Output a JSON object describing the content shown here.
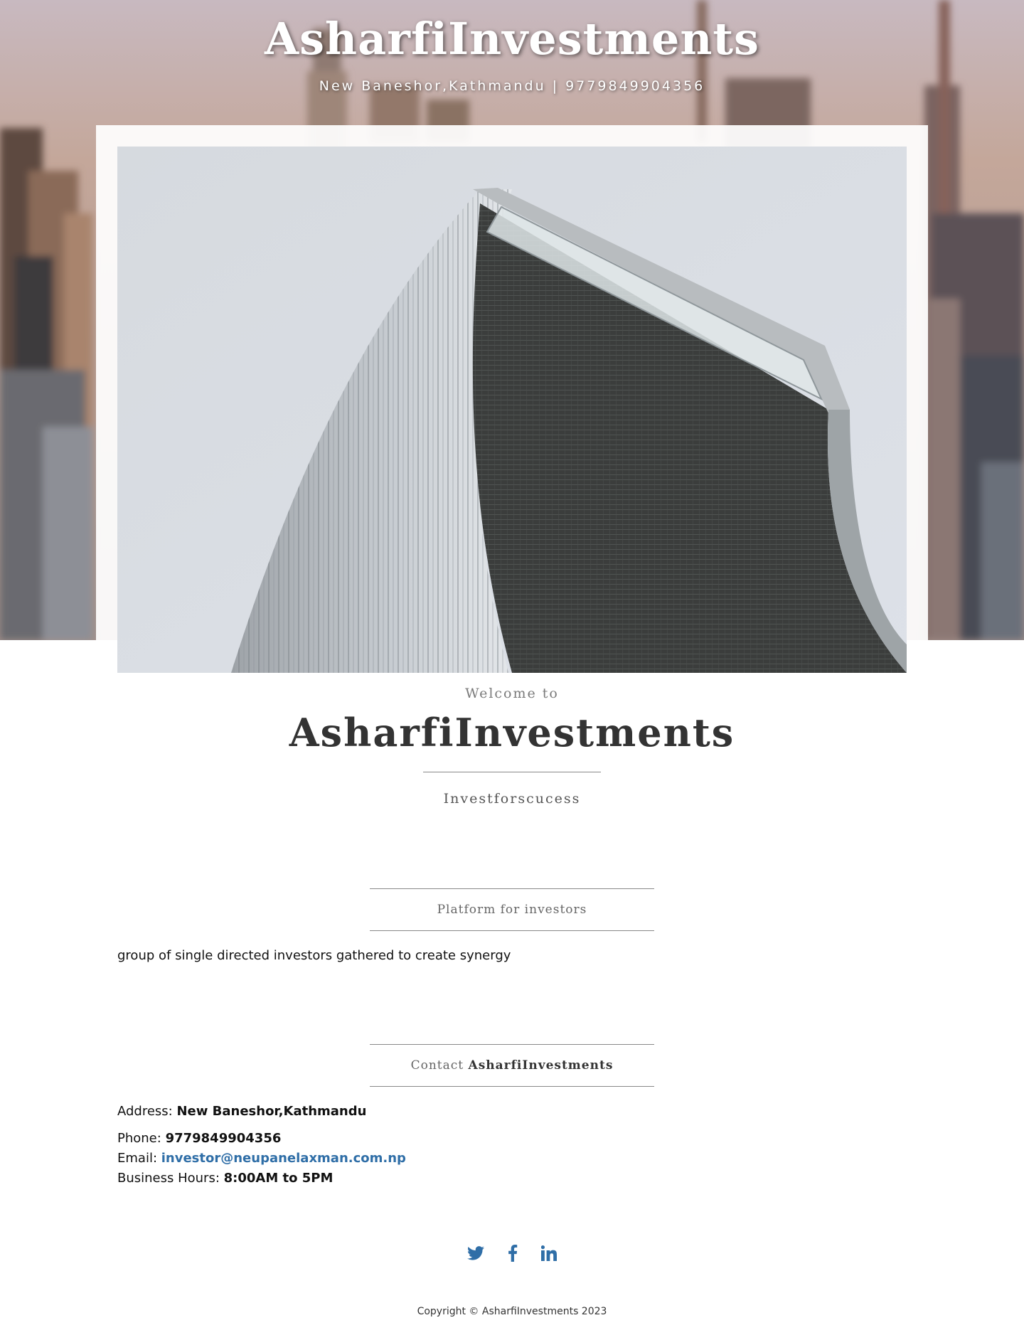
{
  "header": {
    "title": "AsharfiInvestments",
    "tagline": "New Baneshor,Kathmandu | 9779849904356"
  },
  "intro": {
    "welcome_small": "Welcome to",
    "welcome_big": "AsharfiInvestments",
    "motto": "Investforscucess"
  },
  "about": {
    "heading": "Platform for investors",
    "text": "group of single directed investors gathered to create synergy"
  },
  "contact": {
    "heading_prefix": "Contact",
    "heading_name": "AsharfiInvestments",
    "address_label": "Address:",
    "address_value": "New Baneshor,Kathmandu",
    "phone_label": "Phone:",
    "phone_value": "9779849904356",
    "email_label": "Email:",
    "email_value": "investor@neupanelaxman.com.np",
    "hours_label": "Business Hours:",
    "hours_value": "8:00AM to 5PM"
  },
  "social": {
    "icons": [
      "twitter-icon",
      "facebook-icon",
      "linkedin-icon"
    ],
    "color": "#2f6ea7"
  },
  "footer": {
    "copyright": "Copyright © AsharfiInvestments 2023"
  }
}
